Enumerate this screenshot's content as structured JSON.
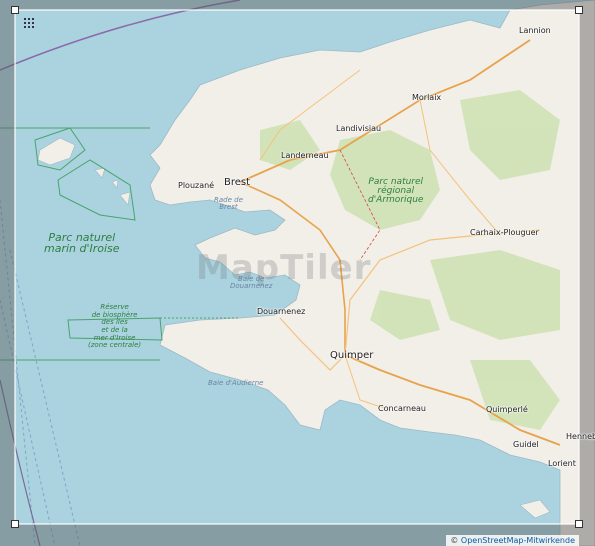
{
  "map": {
    "colors": {
      "sea": "#aad3df",
      "land": "#f2efe9",
      "forest": "#c8dfb0",
      "dim": "rgba(90,90,90,0.45)",
      "park_line": "#4aa36a",
      "road": "#e8a34a",
      "major_road": "#d8453c"
    },
    "watermark": "MapTiler",
    "attribution": {
      "symbol": "©",
      "text": "OpenStreetMap-Mitwirkende"
    },
    "cities": [
      {
        "name": "Lannion",
        "size": "small"
      },
      {
        "name": "Morlaix",
        "size": "small"
      },
      {
        "name": "Landivisiau",
        "size": "small"
      },
      {
        "name": "Landerneau",
        "size": "small"
      },
      {
        "name": "Brest",
        "size": "big"
      },
      {
        "name": "Plouzané",
        "size": "small"
      },
      {
        "name": "Carhaix-Plouguer",
        "size": "small"
      },
      {
        "name": "Douarnenez",
        "size": "small"
      },
      {
        "name": "Quimper",
        "size": "big"
      },
      {
        "name": "Concarneau",
        "size": "small"
      },
      {
        "name": "Quimperlé",
        "size": "small"
      },
      {
        "name": "Guidel",
        "size": "small"
      },
      {
        "name": "Hennebont",
        "size": "small"
      },
      {
        "name": "Lorient",
        "size": "small"
      }
    ],
    "water_labels": [
      {
        "name": "Rade de\nBrest"
      },
      {
        "name": "Baie de\nDouarnenez"
      },
      {
        "name": "Baie d'Audierne"
      }
    ],
    "park_labels": [
      {
        "name": "Parc naturel\nmarin d'Iroise",
        "size": "large"
      },
      {
        "name": "Parc naturel\nrégional\nd'Armorique",
        "size": "med"
      },
      {
        "name": "Réserve\nde biosphère\ndes îles\net de la\nmer d'Iroise\n(zone centrale)",
        "size": "small"
      }
    ]
  }
}
